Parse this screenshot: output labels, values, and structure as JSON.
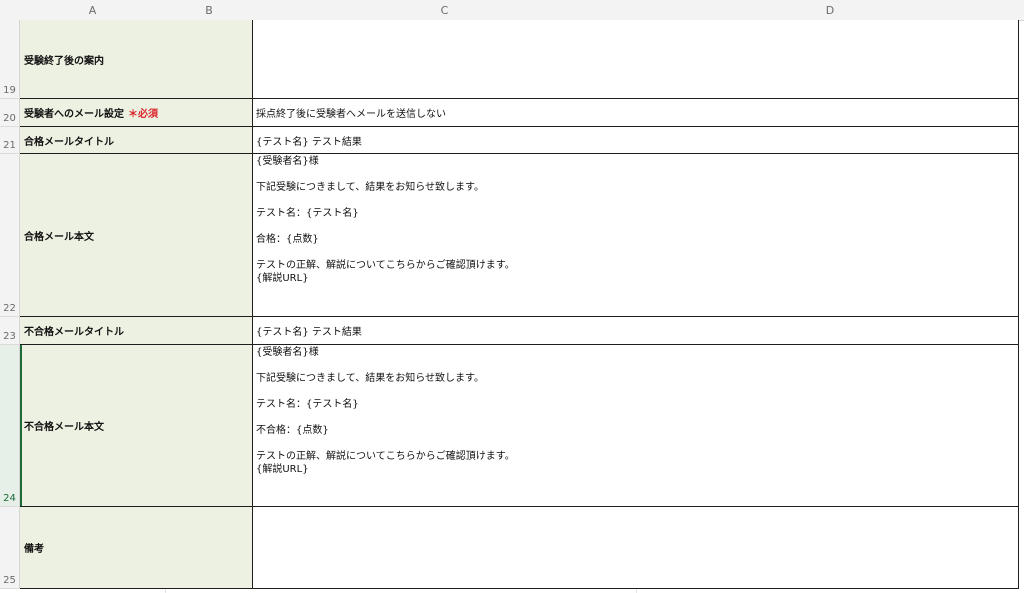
{
  "columns": [
    "A",
    "B",
    "C",
    "D"
  ],
  "rows": {
    "r19": {
      "num": "19",
      "label": "受験終了後の案内",
      "value": ""
    },
    "r20": {
      "num": "20",
      "label": "受験者へのメール設定",
      "required": "＊必須",
      "value": "採点終了後に受験者へメールを送信しない"
    },
    "r21": {
      "num": "21",
      "label": "合格メールタイトル",
      "value": "{テスト名}  テスト結果"
    },
    "r22": {
      "num": "22",
      "label": "合格メール本文",
      "lines": [
        "{受験者名}様",
        "",
        "下記受験につきまして、結果をお知らせ致します。",
        "",
        "テスト名：{テスト名}",
        "",
        "合格：{点数}",
        "",
        "テストの正解、解説についてこちらからご確認頂けます。",
        "{解説URL}"
      ]
    },
    "r23": {
      "num": "23",
      "label": "不合格メールタイトル",
      "value": "{テスト名}  テスト結果"
    },
    "r24": {
      "num": "24",
      "label": "不合格メール本文",
      "lines": [
        "{受験者名}様",
        "",
        "下記受験につきまして、結果をお知らせ致します。",
        "",
        "テスト名：{テスト名}",
        "",
        "不合格：{点数}",
        "",
        "テストの正解、解説についてこちらからご確認頂けます。",
        "{解説URL}"
      ]
    },
    "r25": {
      "num": "25",
      "label": "備考",
      "value": ""
    }
  }
}
